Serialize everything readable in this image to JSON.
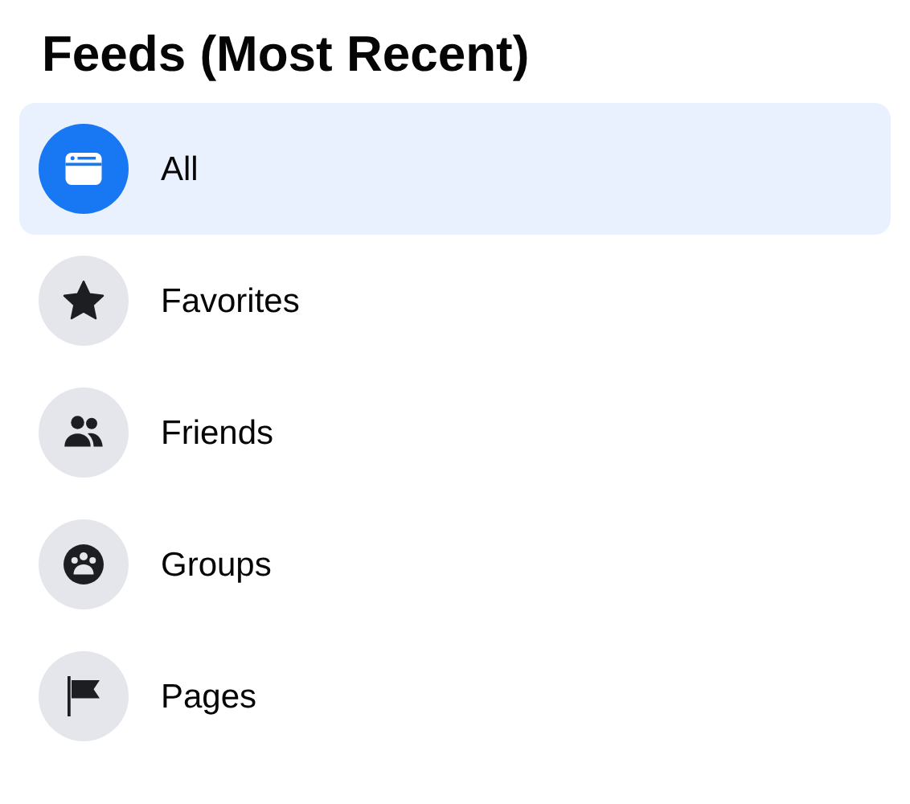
{
  "title": "Feeds (Most Recent)",
  "items": [
    {
      "label": "All",
      "kind": "feed",
      "selected": true
    },
    {
      "label": "Favorites",
      "kind": "star",
      "selected": false
    },
    {
      "label": "Friends",
      "kind": "people",
      "selected": false
    },
    {
      "label": "Groups",
      "kind": "group",
      "selected": false
    },
    {
      "label": "Pages",
      "kind": "flag",
      "selected": false
    }
  ]
}
